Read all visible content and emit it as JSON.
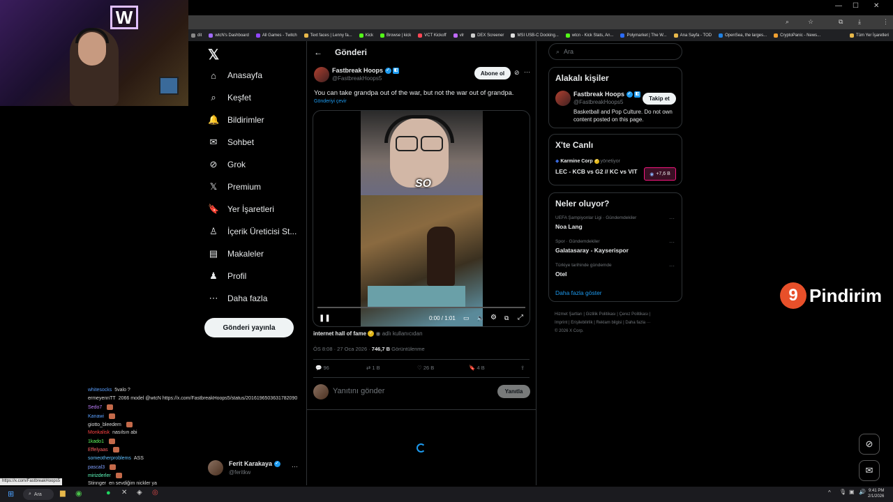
{
  "bookmarks": [
    "dit",
    "wtcN's Dashboard",
    "All Games - Twitch",
    "Text faces | Lenny fa...",
    "Kick",
    "Browse | kick",
    "VCT Kickoff",
    "vlr",
    "DEX Screener",
    "MSI USB-C Docking...",
    "wtcn - Kick Stats, An...",
    "Polymarket | The W...",
    "Ana Sayfa - TOD",
    "OpenSea, the larges...",
    "CryptoPanic - News...",
    "Tüm Yer İşaretleri"
  ],
  "window_controls": {
    "min": "—",
    "max": "☐",
    "close": "✕"
  },
  "nav": {
    "logo": "𝕏",
    "items": [
      {
        "label": "Anasayfa",
        "icon": "⌂"
      },
      {
        "label": "Keşfet",
        "icon": "⌕"
      },
      {
        "label": "Bildirimler",
        "icon": "🔔"
      },
      {
        "label": "Sohbet",
        "icon": "✉"
      },
      {
        "label": "Grok",
        "icon": "⊘"
      },
      {
        "label": "Premium",
        "icon": "𝕏"
      },
      {
        "label": "Yer İşaretleri",
        "icon": "🔖"
      },
      {
        "label": "İçerik Üreticisi St...",
        "icon": "♙"
      },
      {
        "label": "Makaleler",
        "icon": "▤"
      },
      {
        "label": "Profil",
        "icon": "♟"
      },
      {
        "label": "Daha fazla",
        "icon": "⋯"
      }
    ],
    "post_button": "Gönderi yayınla",
    "account": {
      "name": "Ferit Karakaya",
      "handle": "@feritkw",
      "more": "···"
    }
  },
  "header": {
    "back": "←",
    "title": "Gönderi"
  },
  "tweet": {
    "author_name": "Fastbreak Hoops",
    "author_handle": "@FastbreakHoops5",
    "follow_label": "Abone ol",
    "text": "You can take grandpa out of the war, but not the war out of grandpa.",
    "translate": "Gönderiyi çevir",
    "video_caption": "SO",
    "video_time": "0:00 / 1:01",
    "credit_name": "internet hall of fame",
    "credit_suffix": "adlı kullanıcıdan",
    "timestamp": "ÖS 8:08 · 27 Oca 2026 · ",
    "views_count": "746,7 B",
    "views_label": " Görüntülenme",
    "actions": {
      "replies": "96",
      "retweets": "1 B",
      "likes": "26 B",
      "bookmarks": "4 B"
    },
    "reply_placeholder": "Yanıtını gönder",
    "reply_button": "Yanıtla"
  },
  "search": {
    "placeholder": "Ara"
  },
  "related": {
    "title": "Alakalı kişiler",
    "name": "Fastbreak Hoops",
    "handle": "@FastbreakHoops5",
    "follow": "Takip et",
    "bio": "Basketball and Pop Culture. Do not own content posted on this page."
  },
  "live": {
    "title": "X'te Canlı",
    "host": "Karmine Corp",
    "host_suffix": "yönetiyor",
    "event": "LEC - KCB vs G2 // KC vs VIT",
    "count": "+7,6 B"
  },
  "trends": {
    "title": "Neler oluyor?",
    "items": [
      {
        "context": "UEFA Şampiyonlar Ligi · Gündemdekiler",
        "name": "Noa Lang"
      },
      {
        "context": "Spor · Gündemdekiler",
        "name": "Galatasaray - Kayserispor"
      },
      {
        "context": "Türkiye tarihinde gündemde",
        "name": "Otel"
      }
    ],
    "show_more": "Daha fazla göster"
  },
  "footer": {
    "line1": "Hizmet Şartları  |  Gizlilik Politikası  |  Çerez Politikası  |",
    "line2": "Imprint  |  Erişilebilirlik  |  Reklam bilgisi  |  Daha fazla ···",
    "line3": "© 2026 X Corp."
  },
  "chat": [
    {
      "user": "whitesocks",
      "color": "#5aa0ff",
      "msg": "5valo ?"
    },
    {
      "user": "ermeyennTT",
      "color": "#dddddd",
      "msg": "2066 model @wtcN https://x.com/FastbreakHoops5/status/2016196503631782090"
    },
    {
      "user": "Sedo7",
      "color": "#c080ff",
      "msg": ""
    },
    {
      "user": "Kanawi",
      "color": "#5aa0ff",
      "msg": ""
    },
    {
      "user": "giotto_bleedem",
      "color": "#dddddd",
      "msg": ""
    },
    {
      "user": "Monkalisk",
      "color": "#ff4444",
      "msg": "nasılsın abi"
    },
    {
      "user": "1kado1",
      "color": "#60ff60",
      "msg": ""
    },
    {
      "user": "Effelyaas",
      "color": "#ff6060",
      "msg": ""
    },
    {
      "user": "someotherproblems",
      "color": "#60c0ff",
      "msg": "ASS"
    },
    {
      "user": "pascal3",
      "color": "#80a0ff",
      "msg": ""
    },
    {
      "user": "mirizderler",
      "color": "#60ffc0",
      "msg": ""
    },
    {
      "user": "Stinnger",
      "color": "#dddddd",
      "msg": "en sevdiğim nickler ya"
    }
  ],
  "status_url": "https://x.com/FastbreakHoops5",
  "taskbar": {
    "search": "Ara",
    "time": "9:41 PM",
    "date": "2/1/2026"
  },
  "overlay": {
    "brand": "Pindirim",
    "brand_mark": "9"
  }
}
